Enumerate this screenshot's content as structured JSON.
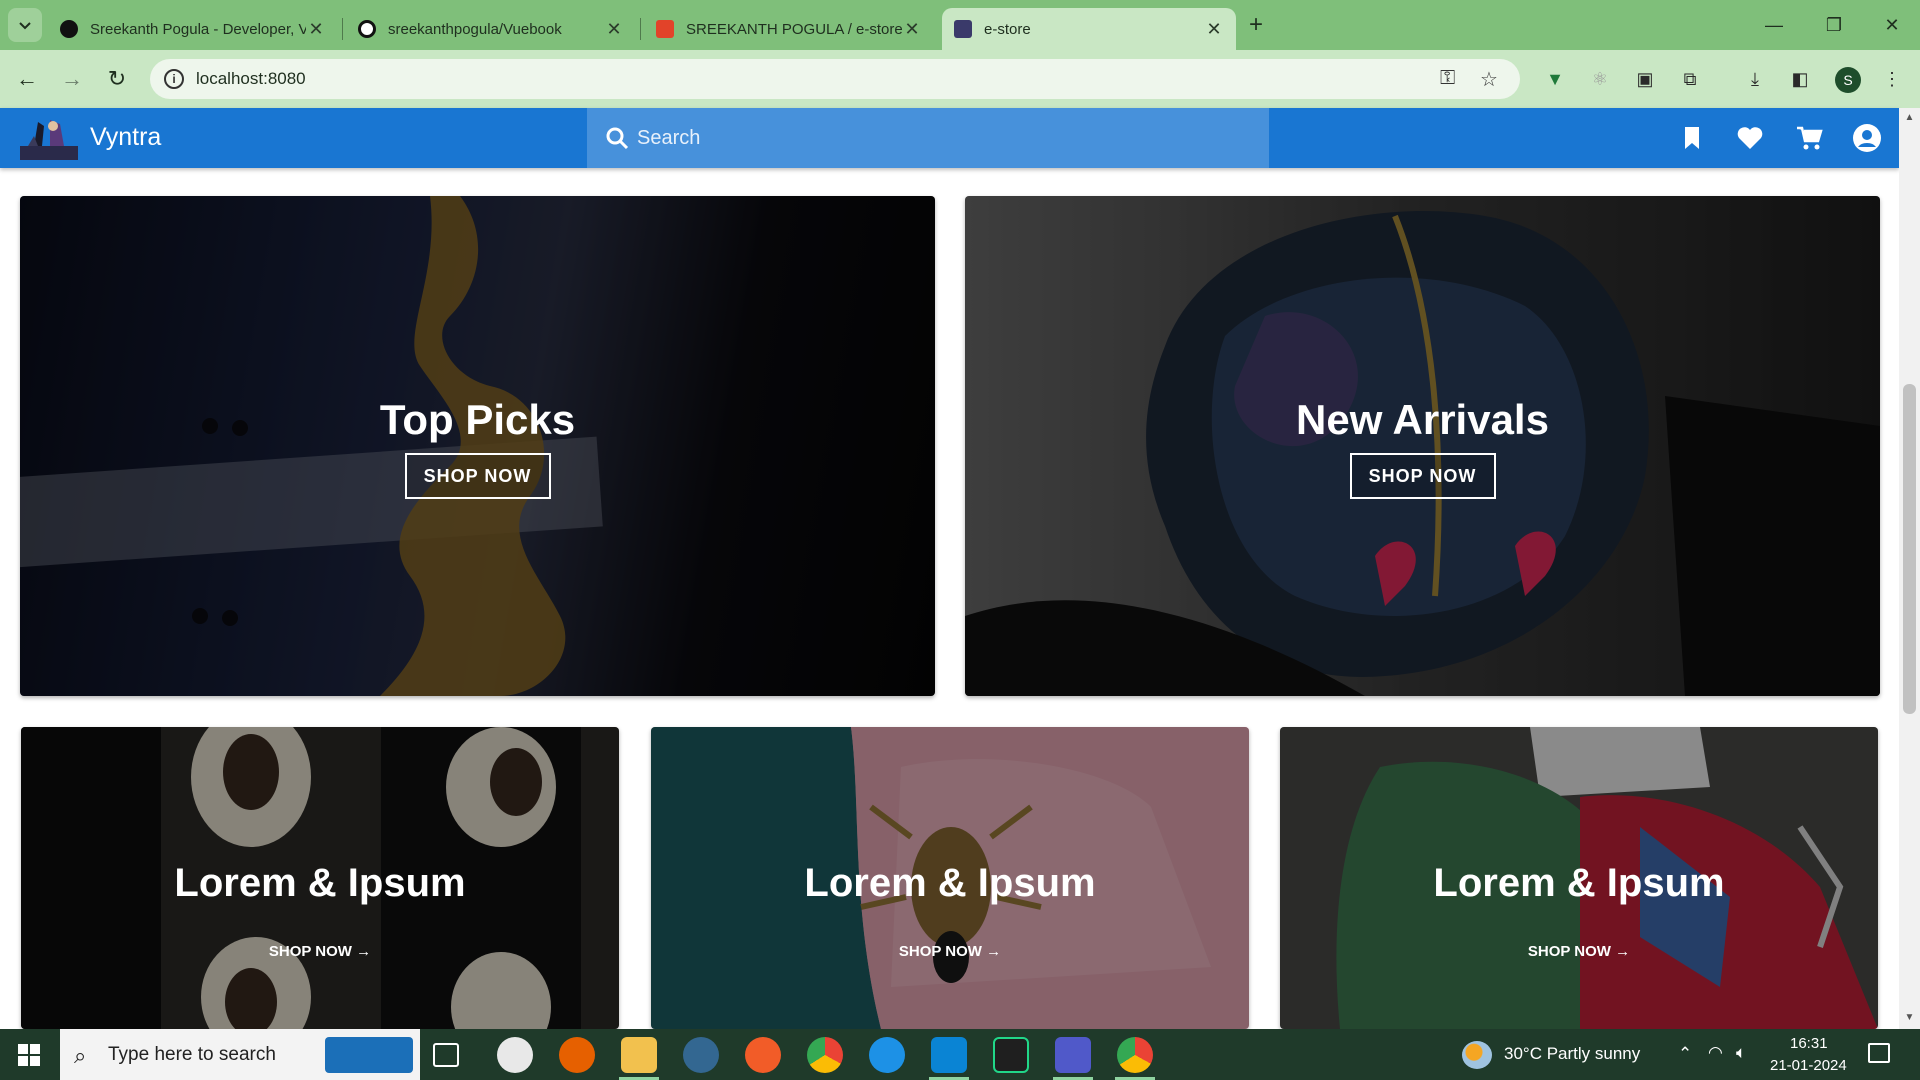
{
  "browser": {
    "tabs": [
      {
        "title": "Sreekanth Pogula - Developer, V",
        "active": false
      },
      {
        "title": "sreekanthpogula/Vuebook",
        "active": false
      },
      {
        "title": "SREEKANTH POGULA / e-store",
        "active": false
      },
      {
        "title": "e-store",
        "active": true
      }
    ],
    "url": "localhost:8080",
    "profile_initial": "S"
  },
  "app": {
    "brand": "Vyntra",
    "search_placeholder": "Search",
    "header_icons": [
      "bookmark-icon",
      "heart-icon",
      "cart-icon",
      "account-icon"
    ],
    "accent": "#1976d2"
  },
  "hero_cards": [
    {
      "title": "Top Picks",
      "cta": "SHOP NOW"
    },
    {
      "title": "New Arrivals",
      "cta": "SHOP NOW"
    }
  ],
  "promo_cards": [
    {
      "title": "Lorem & Ipsum",
      "cta": "SHOP NOW →"
    },
    {
      "title": "Lorem & Ipsum",
      "cta": "SHOP NOW →"
    },
    {
      "title": "Lorem & Ipsum",
      "cta": "SHOP NOW →"
    }
  ],
  "taskbar": {
    "search_placeholder": "Type here to search",
    "weather": "30°C  Partly sunny",
    "time": "16:31",
    "date": "21-01-2024"
  }
}
